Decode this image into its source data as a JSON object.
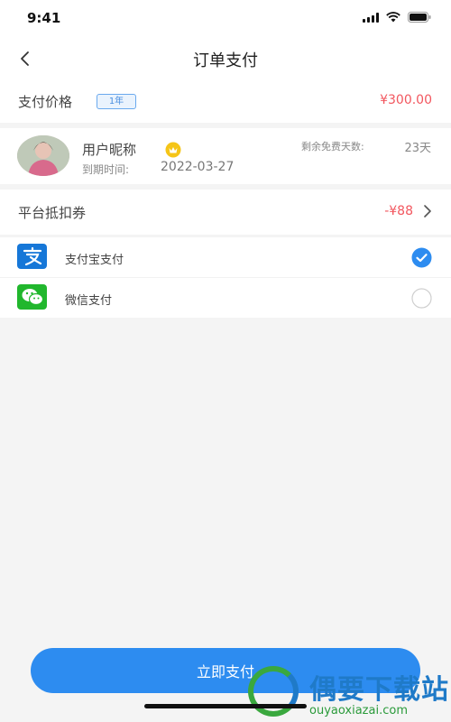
{
  "status_bar": {
    "time": "9:41"
  },
  "nav": {
    "title": "订单支付"
  },
  "price": {
    "label": "支付价格",
    "tag": "1年",
    "value": "¥300.00"
  },
  "user": {
    "name": "用户昵称",
    "expire_label": "到期时间:",
    "expire_date": "2022-03-27",
    "remain_label": "剩余免费天数:",
    "remain_value": "23天"
  },
  "coupon": {
    "label": "平台抵扣券",
    "value": "-¥88"
  },
  "payment_methods": [
    {
      "label": "支付宝支付",
      "icon": "alipay-icon",
      "selected": true
    },
    {
      "label": "微信支付",
      "icon": "wechat-icon",
      "selected": false
    }
  ],
  "action": {
    "pay_label": "立即支付"
  },
  "watermark": {
    "title": "偶要下载站",
    "url": "ouyaoxiazai.com"
  },
  "colors": {
    "accent": "#2d8cf0",
    "price_red": "#f2575f",
    "alipay_blue": "#1677d8",
    "wechat_green": "#21b72d"
  }
}
